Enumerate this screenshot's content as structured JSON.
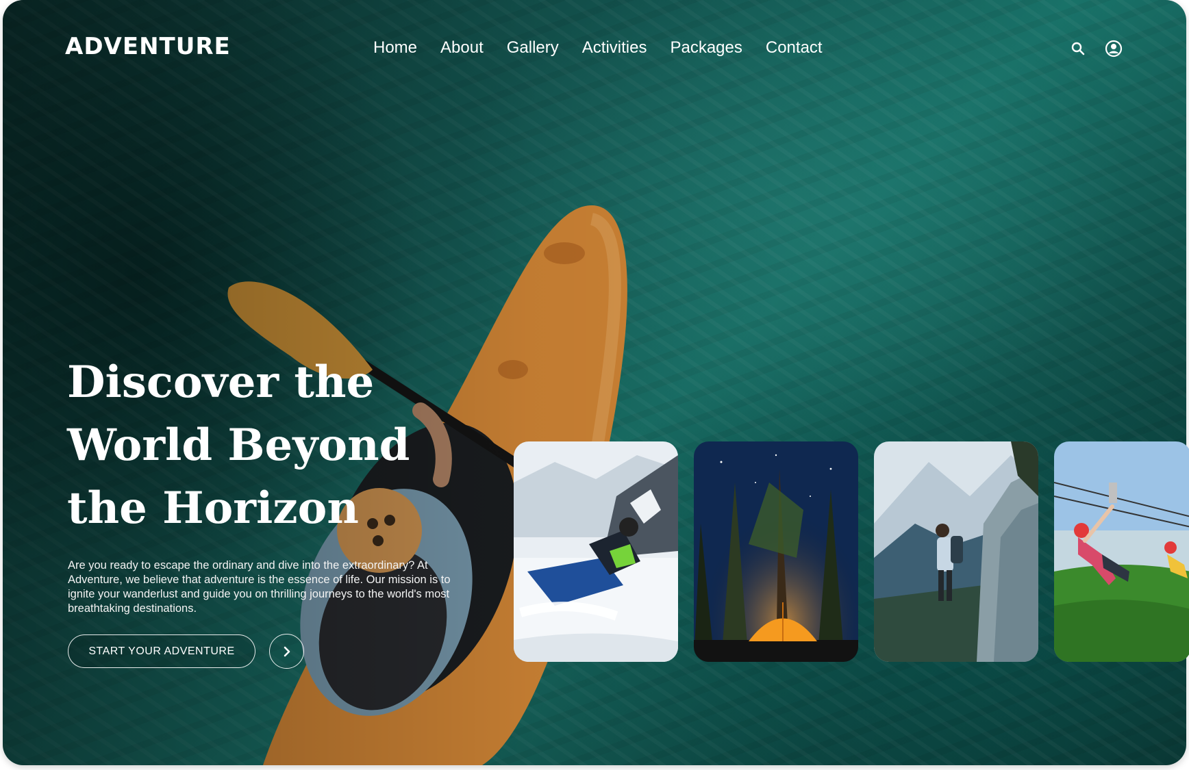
{
  "brand": {
    "logo": "ADVENTURE"
  },
  "nav": {
    "items": [
      "Home",
      "About",
      "Gallery",
      "Activities",
      "Packages",
      "Contact"
    ]
  },
  "header_icons": {
    "search": "search-icon",
    "account": "user-circle-icon"
  },
  "hero": {
    "title": "Discover the World Beyond the Horizon",
    "description": "Are you ready to escape the ordinary and dive into the extraordinary? At Adventure, we believe that adventure is the essence of life. Our mission is to ignite your wanderlust and guide you on thrilling journeys to the world's most breathtaking destinations.",
    "cta_label": "START YOUR ADVENTURE",
    "arrow_icon": "chevron-right-icon"
  },
  "colors": {
    "water": "#16615b",
    "kayak": "#e8943a",
    "text": "#ffffff",
    "tent": "#f59a1f",
    "helmet": "#e23a3a"
  },
  "activity_cards": [
    {
      "image": "snowmobile-photo"
    },
    {
      "image": "camping-tent-photo"
    },
    {
      "image": "mountain-hiker-photo"
    },
    {
      "image": "zipline-photo"
    }
  ]
}
